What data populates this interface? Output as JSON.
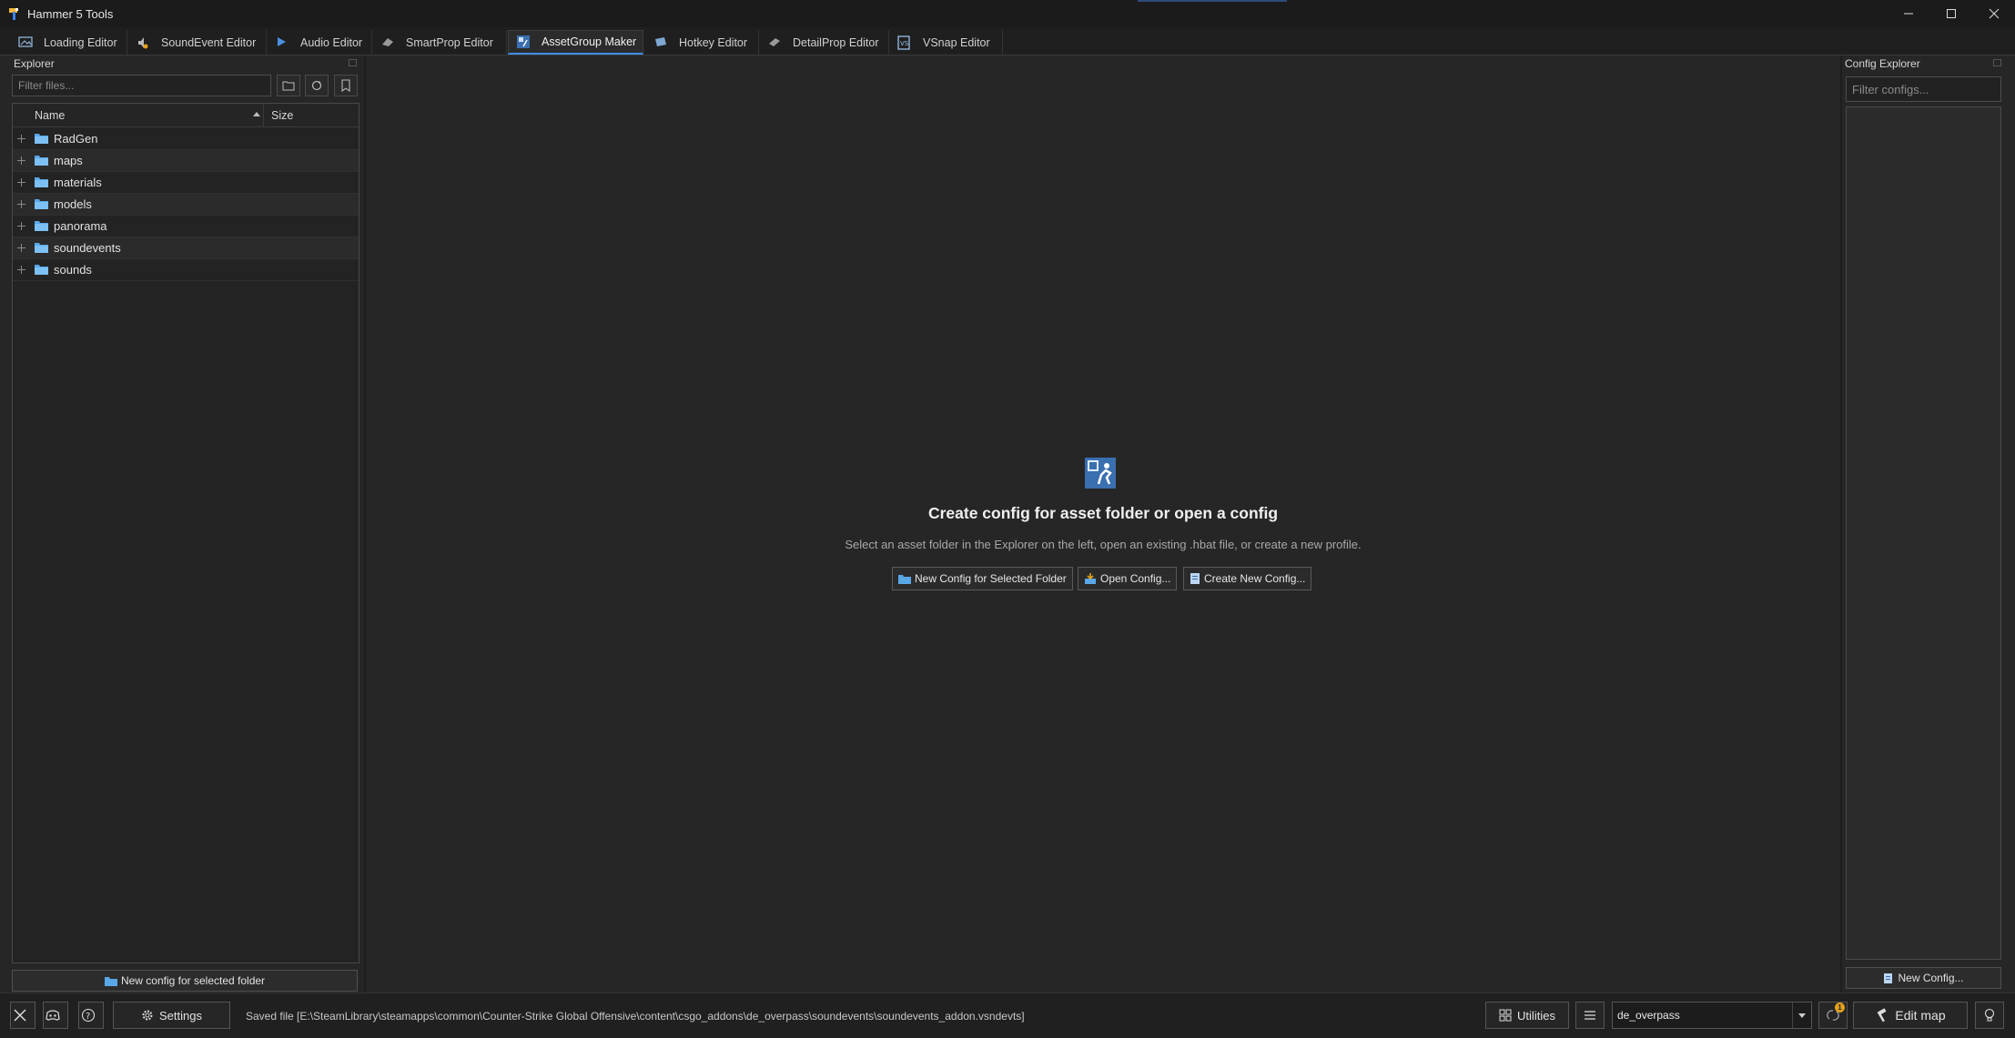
{
  "window": {
    "title": "Hammer 5 Tools",
    "controls": [
      "minimize",
      "maximize",
      "close"
    ]
  },
  "tabs": [
    {
      "label": "Loading Editor",
      "icon": "image-icon"
    },
    {
      "label": "SoundEvent Editor",
      "icon": "speaker-icon"
    },
    {
      "label": "Audio Editor",
      "icon": "play-icon"
    },
    {
      "label": "SmartProp Editor",
      "icon": "prop-icon"
    },
    {
      "label": "AssetGroup Maker",
      "icon": "assetgroup-icon",
      "active": true
    },
    {
      "label": "Hotkey Editor",
      "icon": "keyboard-icon"
    },
    {
      "label": "DetailProp Editor",
      "icon": "detailprop-icon"
    },
    {
      "label": "VSnap Editor",
      "icon": "vsnap-icon"
    }
  ],
  "explorer": {
    "title": "Explorer",
    "filter_placeholder": "Filter files...",
    "columns": {
      "name": "Name",
      "size": "Size"
    },
    "folders": [
      "RadGen",
      "maps",
      "materials",
      "models",
      "panorama",
      "soundevents",
      "sounds"
    ],
    "new_config_button": "New config for selected folder"
  },
  "center": {
    "heading": "Create config for asset folder or open a config",
    "subtext": "Select an asset folder in the Explorer on the left, open an existing .hbat file, or create a new profile.",
    "buttons": {
      "new_for_folder": "New Config for Selected Folder",
      "open": "Open Config...",
      "create": "Create New Config..."
    }
  },
  "config_explorer": {
    "title": "Config Explorer",
    "filter_placeholder": "Filter configs...",
    "new_button": "New Config..."
  },
  "statusbar": {
    "settings_label": "Settings",
    "status_message": "Saved file [E:\\SteamLibrary\\steamapps\\common\\Counter-Strike Global Offensive\\content\\csgo_addons\\de_overpass\\soundevents\\soundevents_addon.vsndevts]",
    "utilities_label": "Utilities",
    "map_value": "de_overpass",
    "update_badge": "1",
    "edit_map_label": "Edit map"
  },
  "colors": {
    "accent": "#3f8ee6",
    "background": "#262626",
    "badge": "#e3a21a"
  }
}
